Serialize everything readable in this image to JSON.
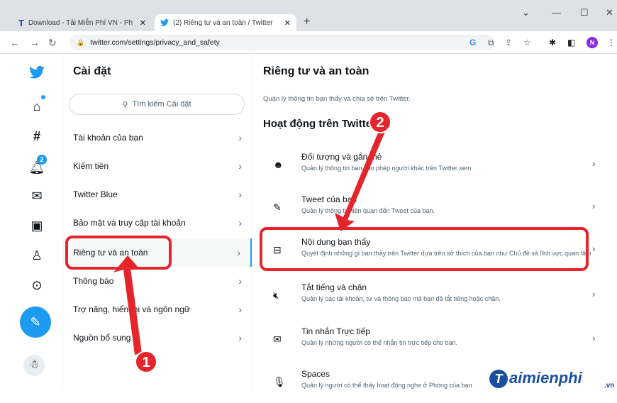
{
  "browser": {
    "tabs": [
      {
        "icon": "T",
        "title": "Download - Tải Miễn Phí VN - Ph",
        "close": "✕"
      },
      {
        "icon": "🐦",
        "title": "(2) Riêng tư và an toàn / Twitter",
        "close": "✕"
      }
    ],
    "new_tab": "+",
    "window_controls": {
      "dropdown": "⌄",
      "minimize": "—",
      "maximize": "☐",
      "close": "✕"
    },
    "nav": {
      "back": "←",
      "forward": "→",
      "reload": "↻"
    },
    "url": "twitter.com/settings/privacy_and_safety",
    "profile_initial": "N"
  },
  "sidebar": {
    "notification_count": "2"
  },
  "settings": {
    "title": "Cài đặt",
    "search_placeholder": "Tìm kiếm Cài đặt",
    "items": [
      {
        "label": "Tài khoản của bạn"
      },
      {
        "label": "Kiếm tiền"
      },
      {
        "label": "Twitter Blue"
      },
      {
        "label": "Bảo mật và truy cập tài khoản"
      },
      {
        "label": "Riêng tư và an toàn"
      },
      {
        "label": "Thông báo"
      },
      {
        "label": "Trợ năng, hiển thị và ngôn ngữ"
      },
      {
        "label": "Nguồn bổ sung"
      }
    ]
  },
  "main": {
    "title": "Riêng tư và an toàn",
    "description": "Quản lý thông tin bạn thấy và chia sẻ trên Twitter.",
    "section_title": "Hoạt động trên Twitter",
    "rows": [
      {
        "title": "Đối tượng và gắn thẻ",
        "desc": "Quản lý thông tin bạn cho phép người khác trên Twitter xem."
      },
      {
        "title": "Tweet của bạn",
        "desc": "Quản lý thông tin liên quan đến Tweet của bạn."
      },
      {
        "title": "Nội dung bạn thấy",
        "desc": "Quyết định những gì bạn thấy trên Twitter dựa trên sở thích của bạn như Chủ đề và lĩnh vực quan tâm"
      },
      {
        "title": "Tắt tiếng và chặn",
        "desc": "Quản lý các tài khoản, từ và thông báo mà bạn đã tắt tiếng hoặc chặn."
      },
      {
        "title": "Tin nhắn Trực tiếp",
        "desc": "Quản lý những người có thể nhắn tin trực tiếp cho bạn."
      },
      {
        "title": "Spaces",
        "desc": "Quản lý người có thể thấy hoạt động nghe ở Phòng của bạn"
      }
    ]
  },
  "annotations": {
    "step1": "1",
    "step2": "2",
    "color": "#e4252b"
  },
  "watermark": {
    "initial": "T",
    "text": "aimienphi",
    "suffix": ".vn"
  }
}
